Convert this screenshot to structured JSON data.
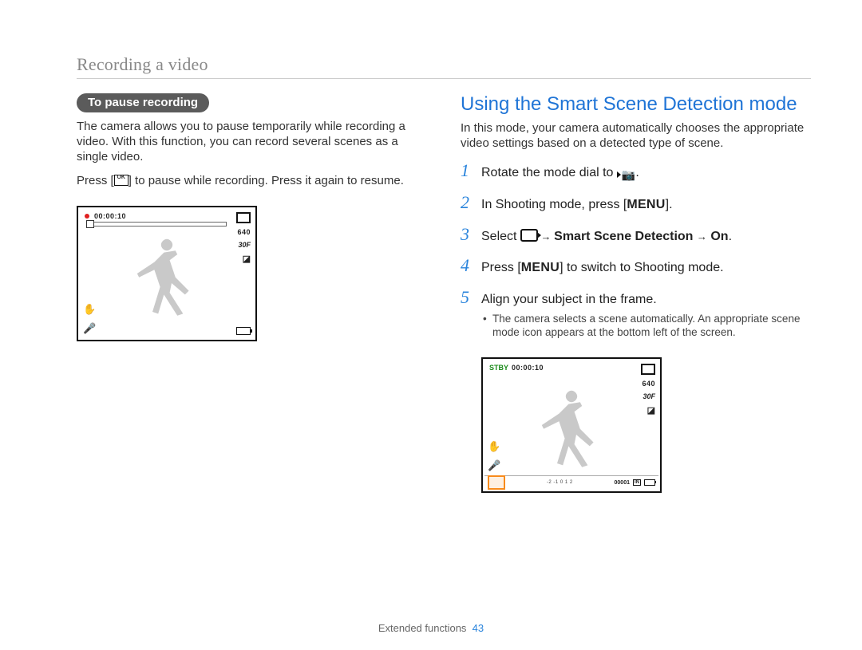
{
  "header": {
    "section_title": "Recording a video"
  },
  "left": {
    "pill": "To pause recording",
    "para1": "The camera allows you to pause temporarily while recording a video. With this function, you can record several scenes as a single video.",
    "para2_pre": "Press [",
    "para2_post": "] to pause while recording. Press it again to resume.",
    "lcd": {
      "timecode": "00:00:10",
      "res": "640",
      "fps": "30F"
    }
  },
  "right": {
    "heading": "Using the Smart Scene Detection mode",
    "intro": "In this mode, your camera automatically chooses the appropriate video settings based on a detected type of scene.",
    "steps": {
      "s1_pre": "Rotate the mode dial to ",
      "s1_post": ".",
      "s2_pre": "In Shooting mode, press [",
      "s2_label": "MENU",
      "s2_post": "].",
      "s3_pre": "Select ",
      "s3_mid": " Smart Scene Detection ",
      "s3_on": " On",
      "s3_post": ".",
      "s4_pre": "Press [",
      "s4_label": "MENU",
      "s4_post": "] to switch to Shooting mode.",
      "s5": "Align your subject in the frame.",
      "s5_bullet": "The camera selects a scene automatically. An appropriate scene mode icon appears at the bottom left of the screen."
    },
    "lcd": {
      "stby": "STBY",
      "timecode": "00:00:10",
      "res": "640",
      "fps": "30F",
      "ev_scale": "-2 -1  0  1  2",
      "counter": "00001",
      "in": "IN"
    }
  },
  "footer": {
    "label": "Extended functions",
    "page": "43"
  }
}
